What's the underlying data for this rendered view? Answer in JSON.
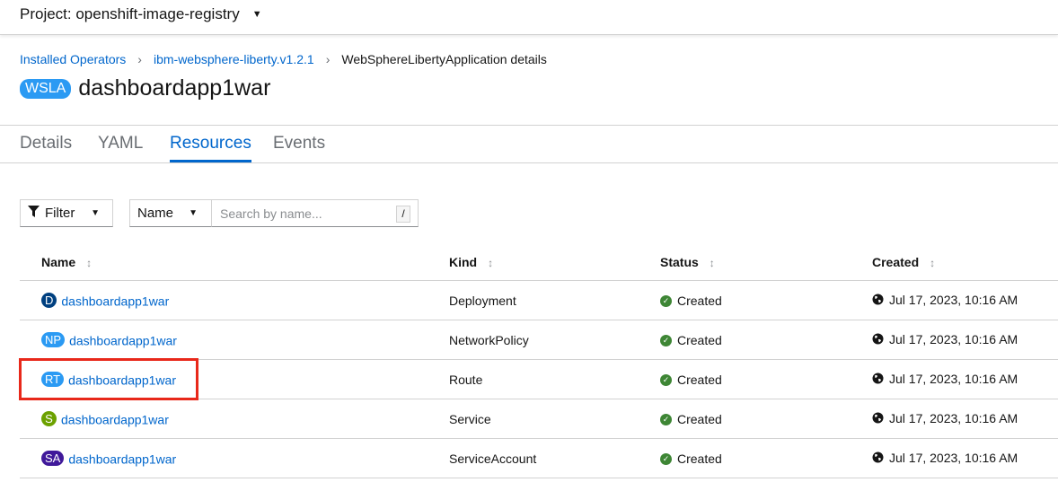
{
  "project": {
    "label": "Project: openshift-image-registry"
  },
  "breadcrumb": [
    {
      "label": "Installed Operators"
    },
    {
      "label": "ibm-websphere-liberty.v1.2.1"
    },
    {
      "label": "WebSphereLibertyApplication details"
    }
  ],
  "header": {
    "badge": "WSLA",
    "title": "dashboardapp1war"
  },
  "tabs": [
    {
      "label": "Details"
    },
    {
      "label": "YAML"
    },
    {
      "label": "Resources"
    },
    {
      "label": "Events"
    }
  ],
  "toolbar": {
    "filter_label": "Filter",
    "name_select": "Name",
    "search_placeholder": "Search by name...",
    "search_hint": "/"
  },
  "table": {
    "columns": [
      "Name",
      "Kind",
      "Status",
      "Created"
    ],
    "rows": [
      {
        "badge": "D",
        "badge_color": "#004080",
        "name": "dashboardapp1war",
        "kind": "Deployment",
        "status": "Created",
        "created": "Jul 17, 2023, 10:16 AM"
      },
      {
        "badge": "NP",
        "badge_color": "#2b9af3",
        "name": "dashboardapp1war",
        "kind": "NetworkPolicy",
        "status": "Created",
        "created": "Jul 17, 2023, 10:16 AM"
      },
      {
        "badge": "RT",
        "badge_color": "#2b9af3",
        "name": "dashboardapp1war",
        "kind": "Route",
        "status": "Created",
        "created": "Jul 17, 2023, 10:16 AM"
      },
      {
        "badge": "S",
        "badge_color": "#6ca100",
        "name": "dashboardapp1war",
        "kind": "Service",
        "status": "Created",
        "created": "Jul 17, 2023, 10:16 AM"
      },
      {
        "badge": "SA",
        "badge_color": "#40199a",
        "name": "dashboardapp1war",
        "kind": "ServiceAccount",
        "status": "Created",
        "created": "Jul 17, 2023, 10:16 AM"
      }
    ]
  },
  "colors": {
    "link": "#0066cc",
    "status_ok": "#3e8635",
    "highlight": "#e8281a"
  }
}
